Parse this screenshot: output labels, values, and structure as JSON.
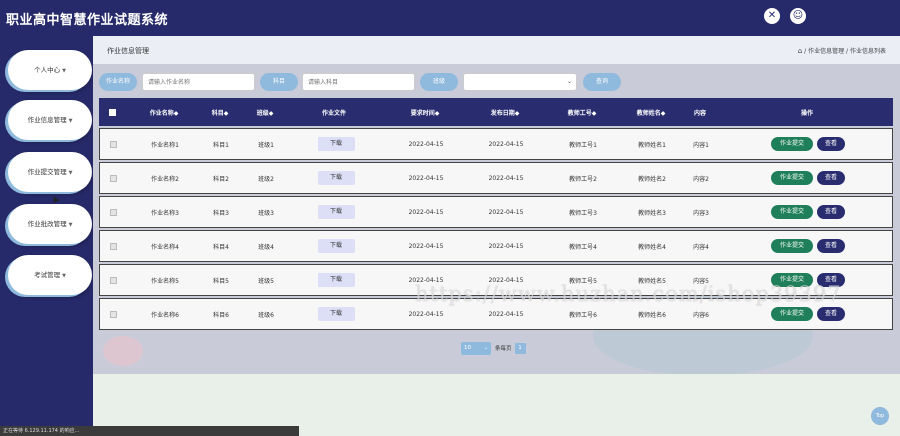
{
  "app": {
    "title": "职业高中智慧作业试题系统"
  },
  "topbar": {
    "fullscreen_icon": "✕",
    "user_icon": "☺"
  },
  "sidebar": {
    "items": [
      {
        "label": "个人中心"
      },
      {
        "label": "作业信息管理"
      },
      {
        "label": "作业提交管理"
      },
      {
        "label": "作业批改管理"
      },
      {
        "label": "考试管理"
      }
    ]
  },
  "header": {
    "page_title": "作业信息管理",
    "breadcrumb": [
      "作业信息管理",
      "作业信息列表"
    ],
    "separator": "/"
  },
  "search": {
    "name_label": "作业名称",
    "name_placeholder": "请输入作业名称",
    "subject_label": "科目",
    "subject_placeholder": "请输入科目",
    "class_label": "班级",
    "search_button": "查询"
  },
  "table": {
    "columns": [
      "作业名称◆",
      "科目◆",
      "班级◆",
      "作业文件",
      "要求时间◆",
      "发布日期◆",
      "教师工号◆",
      "教师姓名◆",
      "内容",
      "操作"
    ],
    "rows": [
      {
        "name": "作业名称1",
        "subject": "科目1",
        "class": "班级1",
        "file": "下载",
        "due": "2022-04-15",
        "published": "2022-04-15",
        "teacher_id": "教师工号1",
        "teacher_name": "教师姓名1",
        "content": "内容1",
        "submit": "作业提交",
        "view": "查看"
      },
      {
        "name": "作业名称2",
        "subject": "科目2",
        "class": "班级2",
        "file": "下载",
        "due": "2022-04-15",
        "published": "2022-04-15",
        "teacher_id": "教师工号2",
        "teacher_name": "教师姓名2",
        "content": "内容2",
        "submit": "作业提交",
        "view": "查看"
      },
      {
        "name": "作业名称3",
        "subject": "科目3",
        "class": "班级3",
        "file": "下载",
        "due": "2022-04-15",
        "published": "2022-04-15",
        "teacher_id": "教师工号3",
        "teacher_name": "教师姓名3",
        "content": "内容3",
        "submit": "作业提交",
        "view": "查看"
      },
      {
        "name": "作业名称4",
        "subject": "科目4",
        "class": "班级4",
        "file": "下载",
        "due": "2022-04-15",
        "published": "2022-04-15",
        "teacher_id": "教师工号4",
        "teacher_name": "教师姓名4",
        "content": "内容4",
        "submit": "作业提交",
        "view": "查看"
      },
      {
        "name": "作业名称5",
        "subject": "科目5",
        "class": "班级5",
        "file": "下载",
        "due": "2022-04-15",
        "published": "2022-04-15",
        "teacher_id": "教师工号5",
        "teacher_name": "教师姓名5",
        "content": "内容5",
        "submit": "作业提交",
        "view": "查看"
      },
      {
        "name": "作业名称6",
        "subject": "科目6",
        "class": "班级6",
        "file": "下载",
        "due": "2022-04-15",
        "published": "2022-04-15",
        "teacher_id": "教师工号6",
        "teacher_name": "教师姓名6",
        "content": "内容6",
        "submit": "作业提交",
        "view": "查看"
      }
    ]
  },
  "pager": {
    "page_size": "10",
    "per_page_label": "条每页",
    "current_page": "1"
  },
  "watermark": "https://www.huzhan.com/ishop39397",
  "back_to_top": "Top",
  "statusbar": "正在等待 6.129.11.174 的响应...",
  "colors": {
    "navy": "#292d6f",
    "accent_blue": "#8fb9dd",
    "green": "#1f7f5b"
  }
}
